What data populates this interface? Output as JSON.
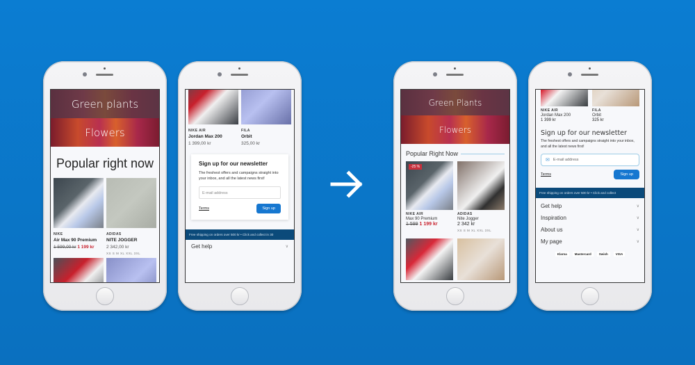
{
  "colors": {
    "background": "#0a76c8",
    "accent": "#1677d0",
    "sale": "#c8202c",
    "shipping_bar": "#0b4a7a"
  },
  "arrow": {
    "icon": "arrow-right-icon"
  },
  "before": {
    "home": {
      "banners": [
        "Green plants",
        "Flowers"
      ],
      "section_title": "Popular right now",
      "products": [
        {
          "brand": "NIKE",
          "name": "Air Max 90 Premium",
          "old_price": "1 599,00 kr",
          "price": "1 199 kr"
        },
        {
          "brand": "ADIDAS",
          "name": "NITE JOGGER",
          "price": "2 342,00 kr",
          "sizes": "XS  S  M  XL  XXL  3XL"
        }
      ]
    },
    "footer_page": {
      "products": [
        {
          "brand": "NIKE AIR",
          "name": "Jordan Max 200",
          "price": "1 399,00 kr"
        },
        {
          "brand": "FILA",
          "name": "Orbit",
          "price": "325,00 kr"
        }
      ],
      "newsletter": {
        "title": "Sign up for our newsletter",
        "text": "The freshest offers and campaigns straight into your inbox, and all the latest news first!",
        "placeholder": "E-mail address",
        "terms": "Terms",
        "button": "Sign up"
      },
      "shipping": "Free shipping on orders over 500 kr  •  Click and collect in 30",
      "accordion": [
        "Get help"
      ]
    }
  },
  "after": {
    "home": {
      "banners": [
        "Green Plants",
        "Flowers"
      ],
      "section_title": "Popular Right Now",
      "products": [
        {
          "badge": "-25 %",
          "brand": "NIKE AIR",
          "name": "Max 90 Premium",
          "old_price": "1 599",
          "price": "1 199 kr"
        },
        {
          "brand": "ADIDAS",
          "name": "Nite Jogger",
          "price": "2 342 kr",
          "sizes": "XS  S  M  XL  XXL  3XL"
        }
      ]
    },
    "footer_page": {
      "products": [
        {
          "brand": "NIKE AIR",
          "name": "Jordan Max 200",
          "price": "1 399 kr"
        },
        {
          "brand": "FILA",
          "name": "Orbit",
          "price": "325 kr"
        }
      ],
      "newsletter": {
        "title": "Sign up for our newsletter",
        "text": "The freshest offers and campaigns straight into your inbox, and all the latest news first!",
        "placeholder": "E-mail address",
        "terms": "Terms",
        "button": "Sign up"
      },
      "shipping": "Free shipping on orders over 500 kr  •  Click and collect",
      "accordion": [
        "Get help",
        "Inspiration",
        "About us",
        "My page"
      ],
      "payments": [
        "Klarna",
        "Mastercard",
        "Swish",
        "VISA"
      ]
    }
  }
}
